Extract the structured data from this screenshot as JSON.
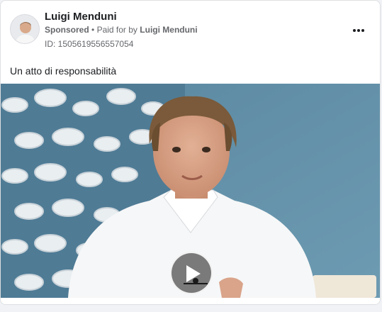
{
  "ad": {
    "advertiser_name": "Luigi Menduni",
    "sponsored_label": "Sponsored",
    "separator": "•",
    "paid_for_prefix": "Paid for by",
    "paid_for_name": "Luigi Menduni",
    "id_text": "ID: 1505619556557054",
    "body_text": "Un atto di responsabilità"
  },
  "icons": {
    "more": "more-horizontal-icon",
    "play": "play-icon"
  },
  "colors": {
    "text_primary": "#1c1e21",
    "text_secondary": "#65676b",
    "background": "#f0f2f5",
    "video_wall": "#5f8fa6"
  }
}
